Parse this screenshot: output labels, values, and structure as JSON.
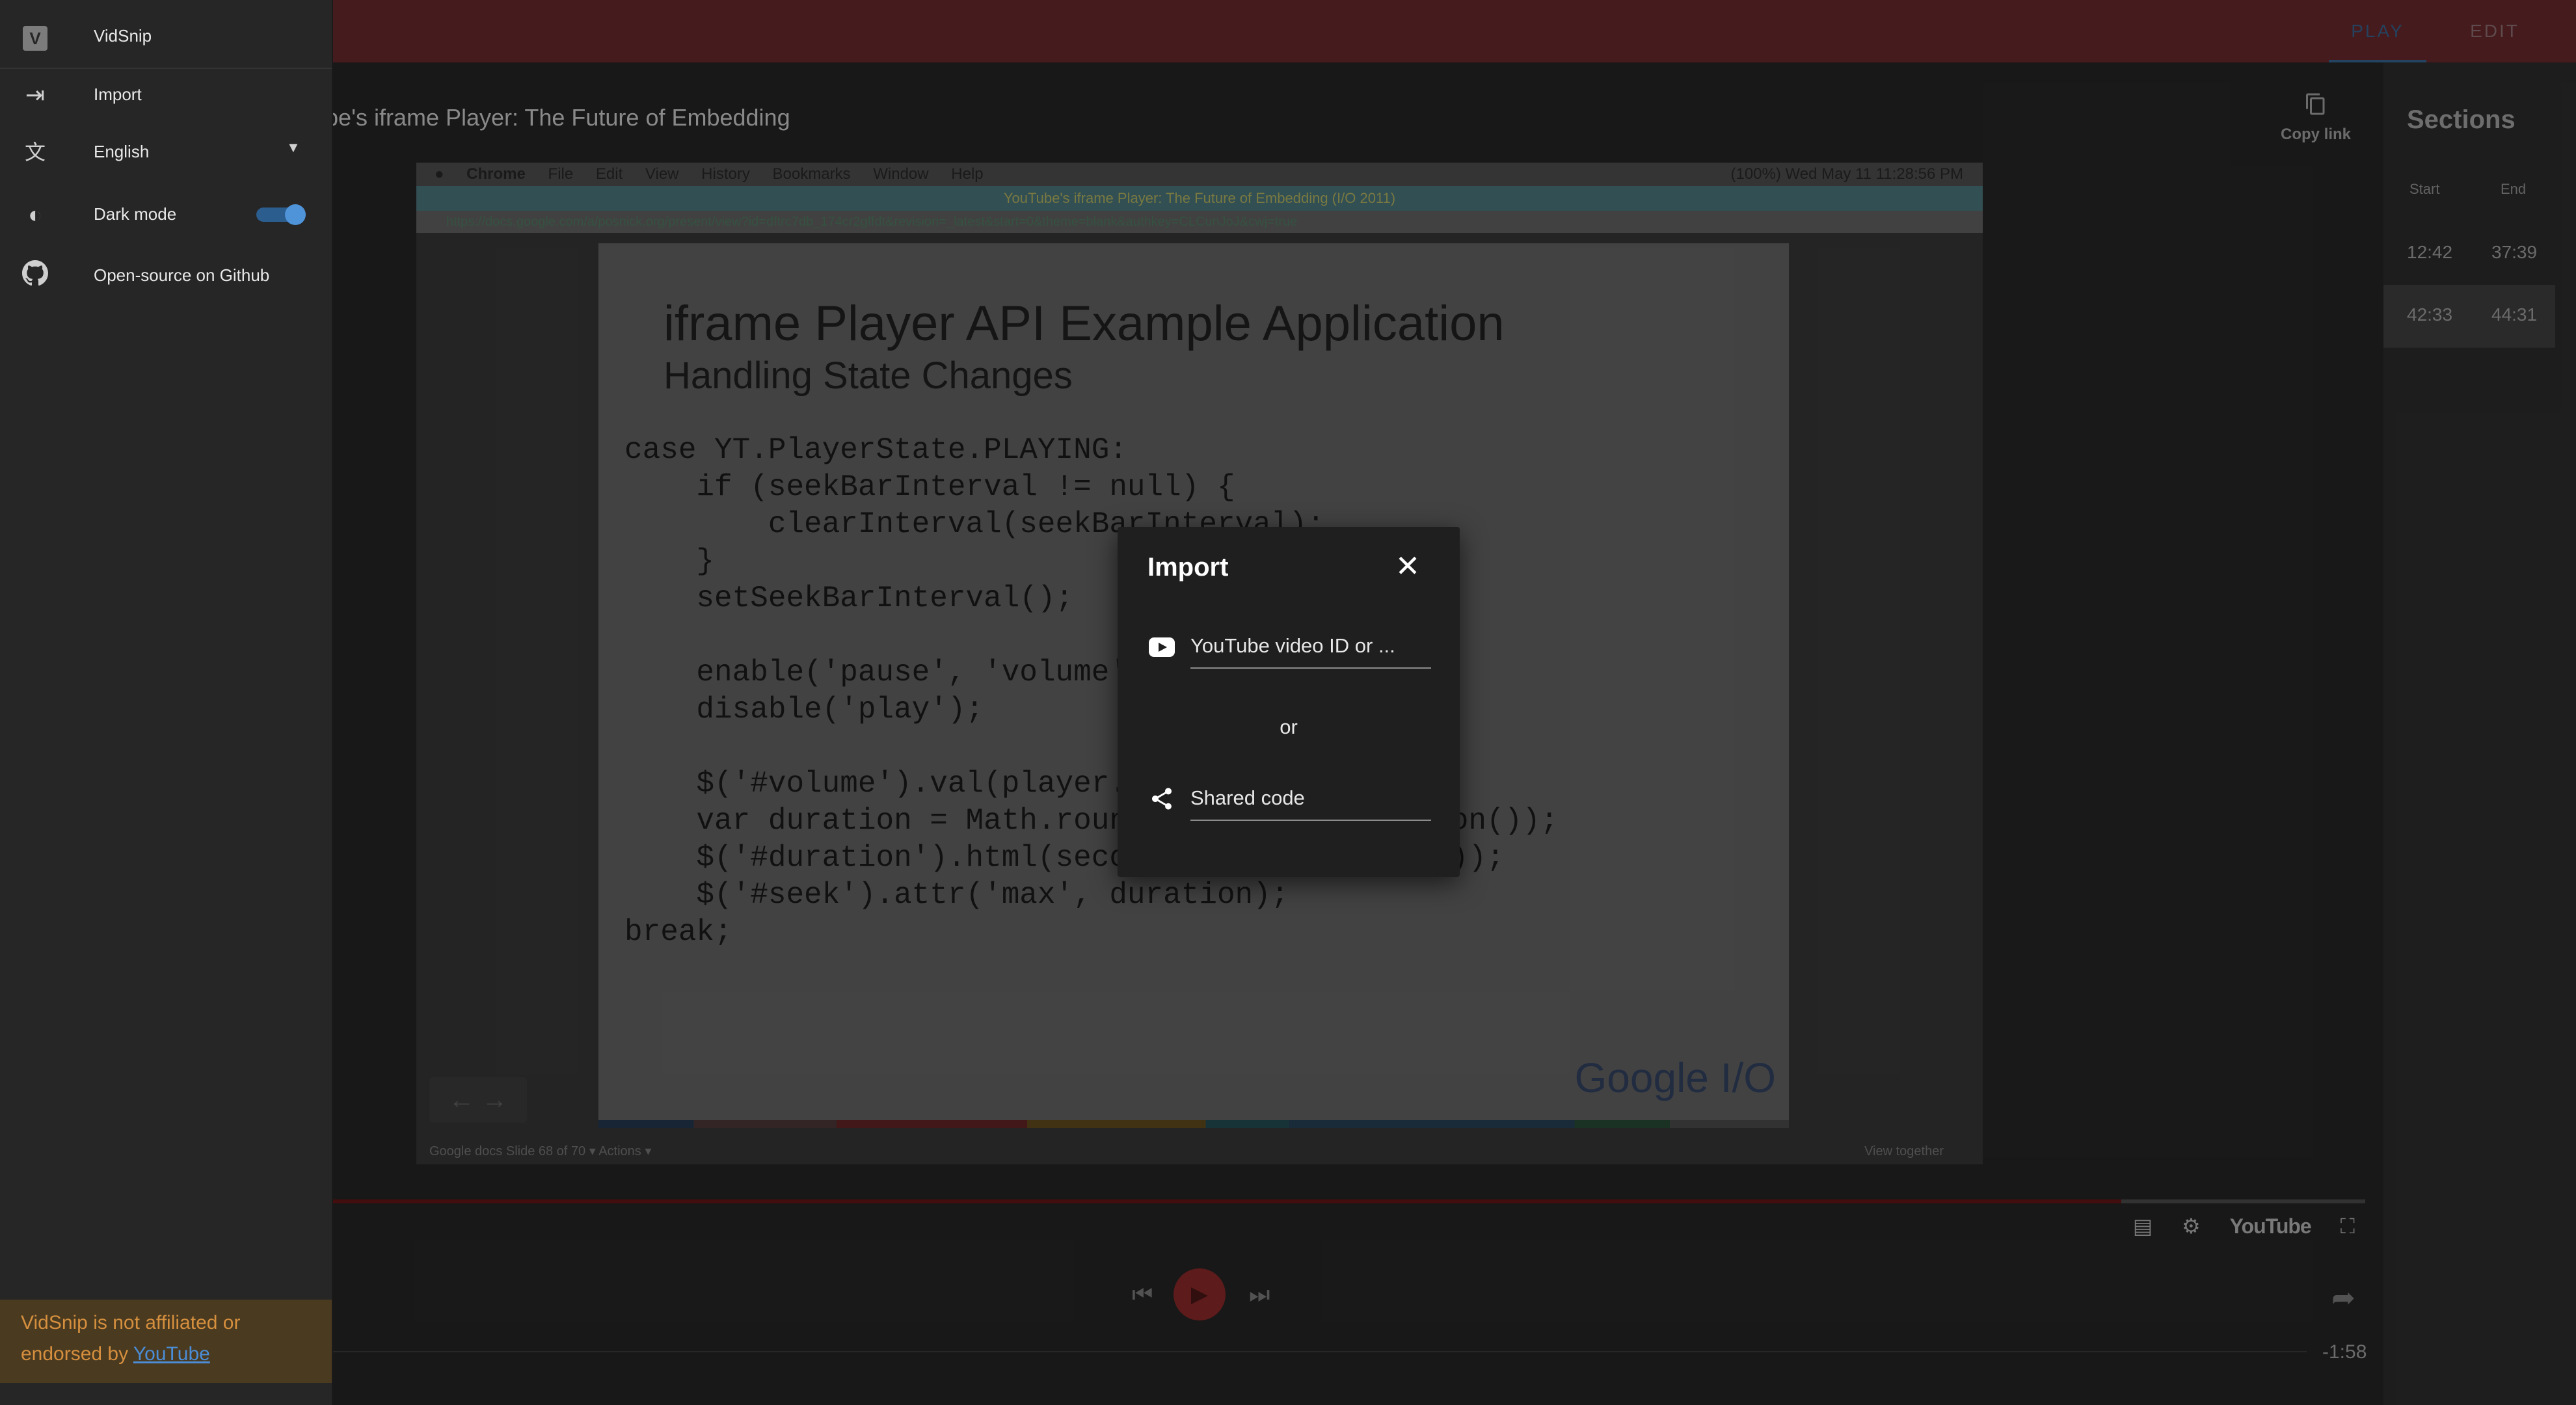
{
  "header": {
    "tabs": [
      {
        "label": "Play",
        "active": true
      },
      {
        "label": "Edit",
        "active": false
      }
    ]
  },
  "video": {
    "title": "ube's iframe Player: The Future of Embedding",
    "copy_link_label": "Copy link",
    "mac_menu": [
      "Chrome",
      "File",
      "Edit",
      "View",
      "History",
      "Bookmarks",
      "Window",
      "Help"
    ],
    "mac_status": "(100%)  Wed May 11  11:28:56 PM",
    "window_title": "YouTube's iframe Player: The Future of Embedding (I/O 2011)",
    "url": "https://docs.google.com/a/posnick.org/present/view?id=dftrc7db_174cr2gffdt&revision=_latest&start=0&theme=blank&authkey=CLCunJoJ&cwj=true",
    "slide": {
      "title": "iframe Player API Example Application",
      "subtitle": "Handling State Changes",
      "code": "case YT.PlayerState.PLAYING:\n    if (seekBarInterval != null) {\n        clearInterval(seekBarInterval);\n    }\n    setSeekBarInterval();\n\n    enable('pause', 'volume');\n    disable('play');\n\n    $('#volume').val(player.getVolume());\n    var duration = Math.round(player.getDuration());\n    $('#duration').html(secondsToTime(duration));\n    $('#seek').attr('max', duration);\nbreak;",
      "logo_text": "Google I/O"
    },
    "docs_bar": "Google docs    Slide 68 of 70 ▾    Actions ▾",
    "docs_bar_right": "View together"
  },
  "player": {
    "progress_fraction": 0.88,
    "youtube_label": "YouTube",
    "time_remaining": "-1:58"
  },
  "sections": {
    "title": "Sections",
    "col_start": "Start",
    "col_end": "End",
    "rows": [
      {
        "start": "12:42",
        "end": "37:39"
      },
      {
        "start": "42:33",
        "end": "44:31"
      }
    ]
  },
  "sidebar": {
    "app_name": "VidSnip",
    "import_label": "Import",
    "language_label": "English",
    "dark_mode_label": "Dark mode",
    "dark_mode_on": true,
    "github_label": "Open-source on Github",
    "disclaimer_text": "VidSnip is not affiliated or endorsed by",
    "disclaimer_link": "YouTube"
  },
  "modal": {
    "title": "Import",
    "video_id_placeholder": "YouTube video ID or ...",
    "or_label": "or",
    "shared_code_placeholder": "Shared code"
  },
  "colors": {
    "accent": "#2a4d6e",
    "topbar": "#501f22",
    "toggle_on": "#4f93d8",
    "disclaimer_bg": "#4a3a20",
    "disclaimer_text": "#d58f3e"
  }
}
